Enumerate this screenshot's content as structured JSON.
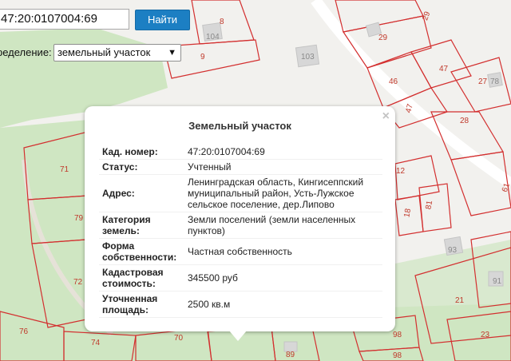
{
  "search": {
    "value": "47:20:0107004:69",
    "button_label": "Найти"
  },
  "definition": {
    "label": "ределение:",
    "selected": "земельный участок"
  },
  "popup": {
    "title": "Земельный участок",
    "close_symbol": "×",
    "rows": [
      {
        "key": "Кад. номер:",
        "value": "47:20:0107004:69"
      },
      {
        "key": "Статус:",
        "value": "Учтенный"
      },
      {
        "key": "Адрес:",
        "value": "Ленинградская область, Кингисеппский муниципальный район, Усть-Лужское сельское поселение, дер.Липово"
      },
      {
        "key": "Категория земель:",
        "value": "Земли поселений (земли населенных пунктов)"
      },
      {
        "key": "Форма собственности:",
        "value": "Частная собственность"
      },
      {
        "key": "Кадастровая стоимость:",
        "value": "345500 руб"
      },
      {
        "key": "Уточненная площадь:",
        "value": "2500 кв.м"
      }
    ]
  },
  "map": {
    "plot_numbers": [
      "8",
      "9",
      "29",
      "29",
      "47",
      "46",
      "27",
      "28",
      "47",
      "71",
      "79",
      "72",
      "76",
      "74",
      "70",
      "89",
      "98",
      "98",
      "93",
      "91",
      "21",
      "23",
      "12",
      "18",
      "81",
      "61"
    ],
    "building_numbers": [
      "104",
      "103",
      "78",
      "93",
      "91"
    ],
    "colors": {
      "background": "#f2f1ee",
      "forest": "#cfe6c2",
      "boundary": "#d32f2f",
      "building": "#d7d7d7",
      "accent": "#1c7fc3"
    }
  }
}
